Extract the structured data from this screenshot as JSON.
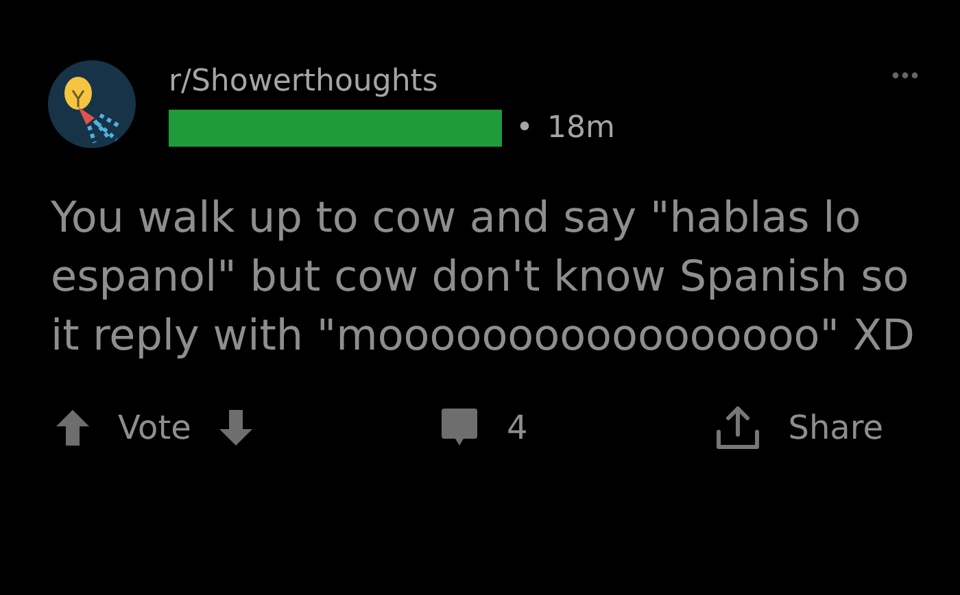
{
  "post": {
    "subreddit": "r/Showerthoughts",
    "author": {
      "redacted": true
    },
    "age": "18m",
    "separator": "•",
    "body": "You walk up to cow and say \"hablas lo espanol\" but cow don't know Spanish so it reply with \"mooooooooooooooooo\" XD"
  },
  "actions": [
    {
      "kind": "vote",
      "label": "Vote"
    },
    {
      "kind": "comments",
      "label": "4"
    },
    {
      "kind": "share",
      "label": "Share"
    }
  ]
}
